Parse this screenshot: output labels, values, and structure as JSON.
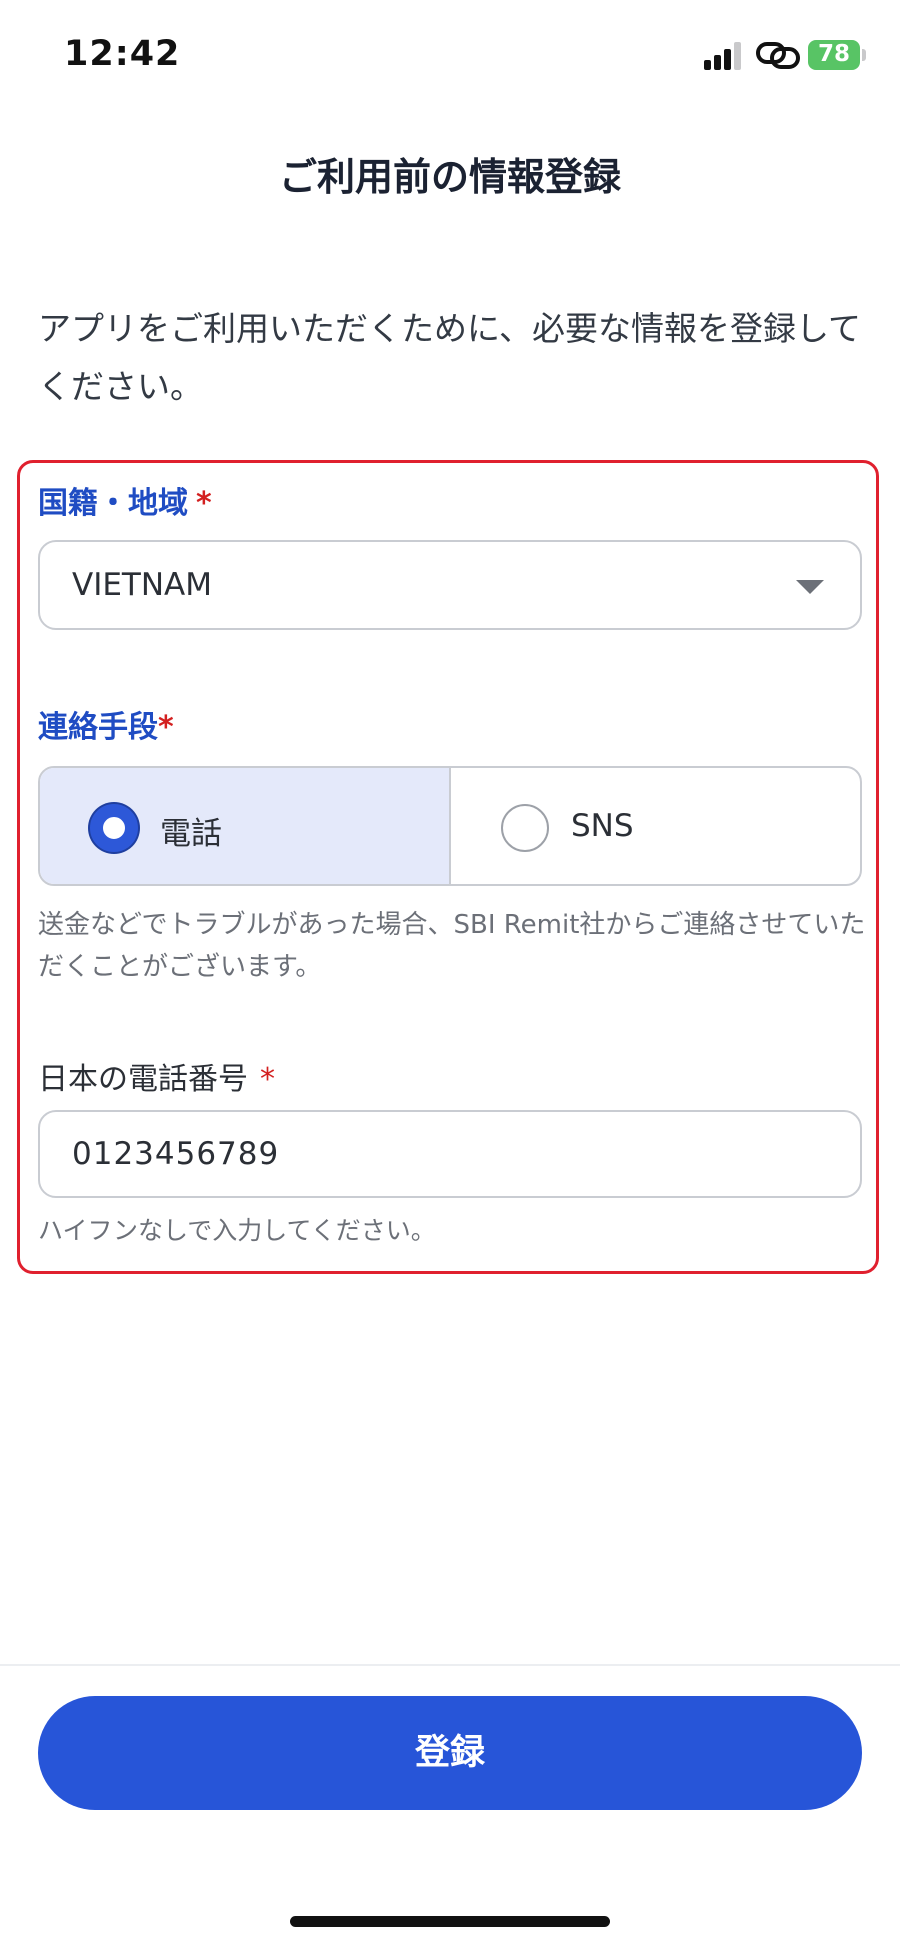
{
  "status_bar": {
    "time": "12:42",
    "battery_level": "78",
    "icons": [
      "cellular-signal-icon",
      "link-icon",
      "battery-charging-icon"
    ]
  },
  "header": {
    "title": "ご利用前の情報登録"
  },
  "intro_text": "アプリをご利用いただくために、必要な情報を登録してください。",
  "form": {
    "country": {
      "label": "国籍・地域",
      "required_mark": "*",
      "value": "VIETNAM"
    },
    "contact_method": {
      "label": "連絡手段",
      "required_mark": "*",
      "options": [
        {
          "label": "電話",
          "selected": true
        },
        {
          "label": "SNS",
          "selected": false
        }
      ],
      "help": "送金などでトラブルがあった場合、SBI Remit社からご連絡させていただくことがございます。"
    },
    "phone": {
      "label": "日本の電話番号",
      "required_mark": "*",
      "value": "0123456789",
      "help": "ハイフンなしで入力してください。"
    }
  },
  "footer": {
    "submit_label": "登録"
  },
  "colors": {
    "accent": "#2755d8",
    "label_blue": "#1f4cc3",
    "required_red": "#d32020",
    "highlight_frame": "#e0202e",
    "selected_bg": "#e4e9fa"
  }
}
